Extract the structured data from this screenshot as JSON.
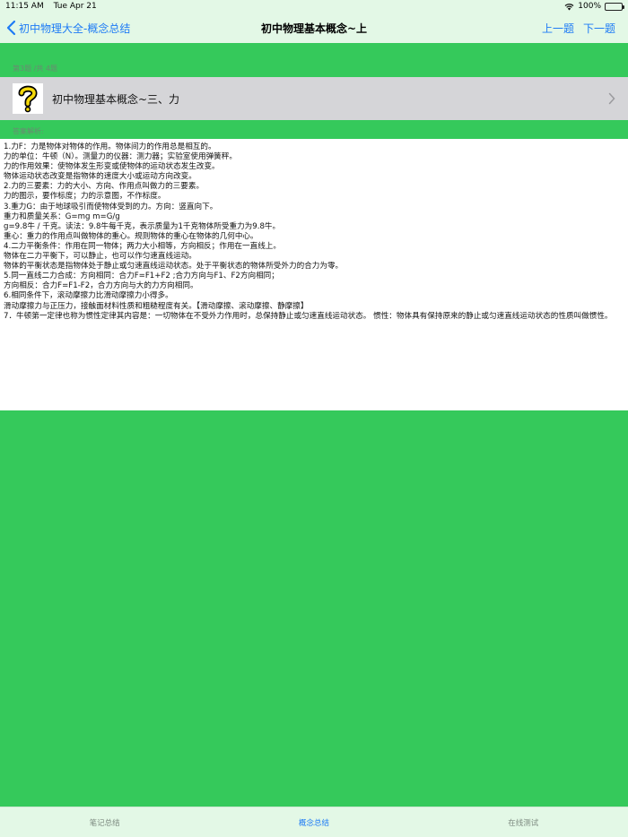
{
  "status_bar": {
    "time": "11:15 AM",
    "date": "Tue Apr 21",
    "battery": "100%",
    "battery_level": 1.0
  },
  "nav": {
    "back_label": "初中物理大全-概念总结",
    "title": "初中物理基本概念~上",
    "prev_label": "上一题",
    "next_label": "下一题"
  },
  "question_counter": "第3题 /共 4题",
  "question": {
    "icon": "question-mark-icon",
    "title": "初中物理基本概念~三、力"
  },
  "answer_header": "答案解析:",
  "answer_lines": [
    "1.力F：力是物体对物体的作用。物体间力的作用总是相互的。",
    "力的单位：牛顿（N）。测量力的仪器：测力器；实验室使用弹簧秤。",
    "力的作用效果：使物体发生形变或使物体的运动状态发生改变。",
    "物体运动状态改变是指物体的速度大小或运动方向改变。",
    "2.力的三要素：力的大小、方向、作用点叫做力的三要素。",
    "力的图示，要作标度；力的示意图，不作标度。",
    "3.重力G：由于地球吸引而使物体受到的力。方向：竖直向下。",
    "重力和质量关系：G=mg m=G/g",
    "g=9.8牛 / 千克。读法：9.8牛每千克，表示质量为1千克物体所受重力为9.8牛。",
    "重心：重力的作用点叫做物体的重心。规则物体的重心在物体的几何中心。",
    "4.二力平衡条件：作用在同一物体；两力大小相等，方向相反；作用在一直线上。",
    "物体在二力平衡下，可以静止，也可以作匀速直线运动。",
    "物体的平衡状态是指物体处于静止或匀速直线运动状态。处于平衡状态的物体所受外力的合力为零。",
    "5.同一直线二力合成：方向相同：合力F=F1+F2 ;合力方向与F1、F2方向相同；",
    "方向相反：合力F=F1-F2，合力方向与大的力方向相同。",
    "6.相同条件下，滚动摩擦力比滑动摩擦力小得多。",
    "滑动摩擦力与正压力，接触面材料性质和粗糙程度有关。【滑动摩擦、滚动摩擦、静摩擦】",
    "7．牛顿第一定律也称为惯性定律其内容是：一切物体在不受外力作用时，总保持静止或匀速直线运动状态。 惯性：物体具有保持原来的静止或匀速直线运动状态的性质叫做惯性。"
  ],
  "tabs": [
    {
      "label": "笔记总结",
      "active": false
    },
    {
      "label": "概念总结",
      "active": true
    },
    {
      "label": "在线测试",
      "active": false
    }
  ],
  "colors": {
    "accent": "#1e7bf5",
    "background_green": "#35c95b",
    "bar_bg": "#e3f8e6"
  }
}
